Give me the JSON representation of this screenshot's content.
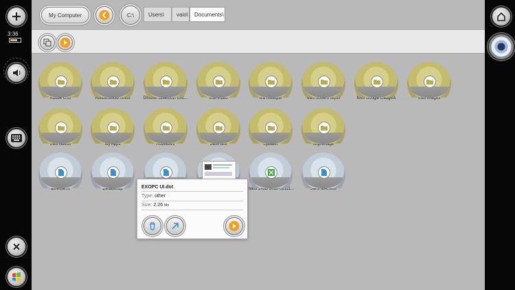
{
  "status": {
    "time": "3:36"
  },
  "breadcrumb": {
    "root": "My Computer",
    "drive": "C:\\",
    "parts": [
      "Users\\",
      "vaio\\",
      "Documents\\"
    ]
  },
  "folders": [
    "Adobe CS3",
    "AdobeStockPhotos",
    "Dossier Bluetooth Exc...",
    "InterVideo",
    "Ma musique",
    "Mes fichiers reçus",
    "Mes Google Gadgets",
    "Mes images",
    "Mes vidéos",
    "My Apps",
    "RobotDev",
    "Sans titre",
    "Updater",
    "virginimage"
  ],
  "files": [
    {
      "name": "adresse.rtf",
      "type": "doc"
    },
    {
      "name": "Default.rdp",
      "type": "doc"
    },
    {
      "name": "",
      "type": "doc"
    },
    {
      "name": "",
      "type": "doc"
    },
    {
      "name": "Inaux 24JD 2010-02111...",
      "type": "xls"
    },
    {
      "name": "Sans titre.nxor",
      "type": "doc"
    }
  ],
  "popup": {
    "title": "EXOPC UI.dot",
    "type_label": "Type:",
    "type_value": "other",
    "size_label": "Size:",
    "size_value": "2.26",
    "size_unit": "Mo"
  },
  "colors": {
    "accent": "#f0a020",
    "folder": "#cfc67a",
    "file": "#d2dde6"
  }
}
